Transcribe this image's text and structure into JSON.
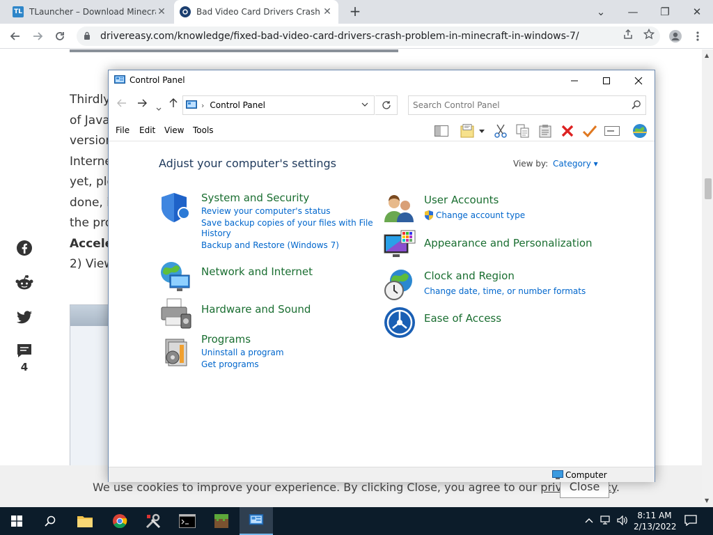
{
  "browser": {
    "tabs": [
      {
        "title": "TLauncher – Download Minecraft",
        "favicon": "TL"
      },
      {
        "title": "Bad Video Card Drivers Crash Minecraft"
      }
    ],
    "tab_close": "✕",
    "new_tab": "+",
    "window_controls": {
      "minimize": "⌄",
      "restore": "—",
      "maximize": "❐",
      "close": "✕"
    },
    "url": "drivereasy.com/knowledge/fixed-bad-video-card-drivers-crash-problem-in-minecraft-in-windows-7/"
  },
  "article": {
    "lines": [
      "Thirdly,",
      "of Java",
      "version",
      "Interne",
      "yet, ple",
      "done, it",
      "the pro",
      "Accele",
      "2) View"
    ],
    "comment_count": "4"
  },
  "cookie": {
    "text_before": "We use cookies to improve your experience. By clicking Close, you agree to our ",
    "link": "privacy policy",
    "text_after": ".",
    "close_label": "Close"
  },
  "control_panel": {
    "title": "Control Panel",
    "address": "Control Panel",
    "search_placeholder": "Search Control Panel",
    "menu": [
      "File",
      "Edit",
      "View",
      "Tools"
    ],
    "heading": "Adjust your computer's settings",
    "view_by_label": "View by:",
    "view_by_value": "Category ▾",
    "categories_left": [
      {
        "title": "System and Security",
        "links": [
          "Review your computer's status",
          "Save backup copies of your files with File",
          "History",
          "Backup and Restore (Windows 7)"
        ]
      },
      {
        "title": "Network and Internet",
        "links": []
      },
      {
        "title": "Hardware and Sound",
        "links": []
      },
      {
        "title": "Programs",
        "links": [
          "Uninstall a program",
          "Get programs"
        ]
      }
    ],
    "categories_right": [
      {
        "title": "User Accounts",
        "links": [
          "Change account type"
        ]
      },
      {
        "title": "Appearance and Personalization",
        "links": []
      },
      {
        "title": "Clock and Region",
        "links": [
          "Change date, time, or number formats"
        ]
      },
      {
        "title": "Ease of Access",
        "links": []
      }
    ],
    "status": "Computer"
  },
  "taskbar": {
    "time": "8:11 AM",
    "date": "2/13/2022"
  }
}
